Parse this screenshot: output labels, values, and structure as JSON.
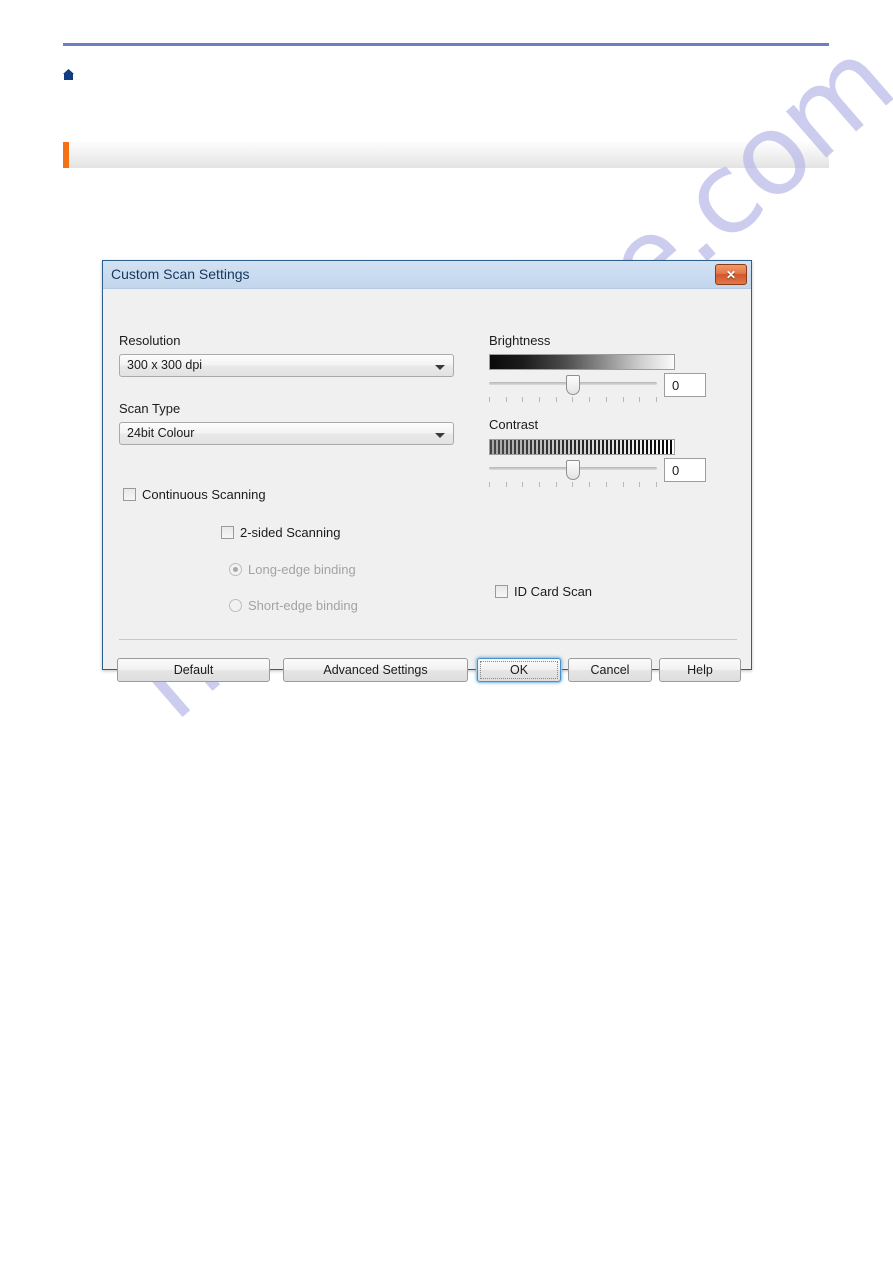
{
  "page": {
    "home_icon": "home-icon",
    "section_bar_label": ""
  },
  "dialog": {
    "title": "Custom Scan Settings",
    "close_label": "✕",
    "resolution": {
      "label": "Resolution",
      "value": "300 x 300 dpi"
    },
    "scan_type": {
      "label": "Scan Type",
      "value": "24bit Colour"
    },
    "continuous_scanning": {
      "label": "Continuous Scanning",
      "checked": false
    },
    "two_sided_scanning": {
      "label": "2-sided Scanning",
      "checked": false
    },
    "long_edge_binding": {
      "label": "Long-edge binding",
      "selected": true,
      "enabled": false
    },
    "short_edge_binding": {
      "label": "Short-edge binding",
      "selected": false,
      "enabled": false
    },
    "brightness": {
      "label": "Brightness",
      "value": "0"
    },
    "contrast": {
      "label": "Contrast",
      "value": "0"
    },
    "id_card_scan": {
      "label": "ID Card Scan",
      "checked": false
    },
    "buttons": {
      "default": "Default",
      "advanced_settings": "Advanced Settings",
      "ok": "OK",
      "cancel": "Cancel",
      "help": "Help"
    }
  },
  "watermark": {
    "text": "manualshive.com"
  },
  "colors": {
    "rule": "#6b80c4",
    "accent": "#f47216",
    "title_bar": "#cadcf0",
    "close_button": "#d2552a",
    "focus": "#4a90c8",
    "watermark": "#b9b9e8"
  }
}
